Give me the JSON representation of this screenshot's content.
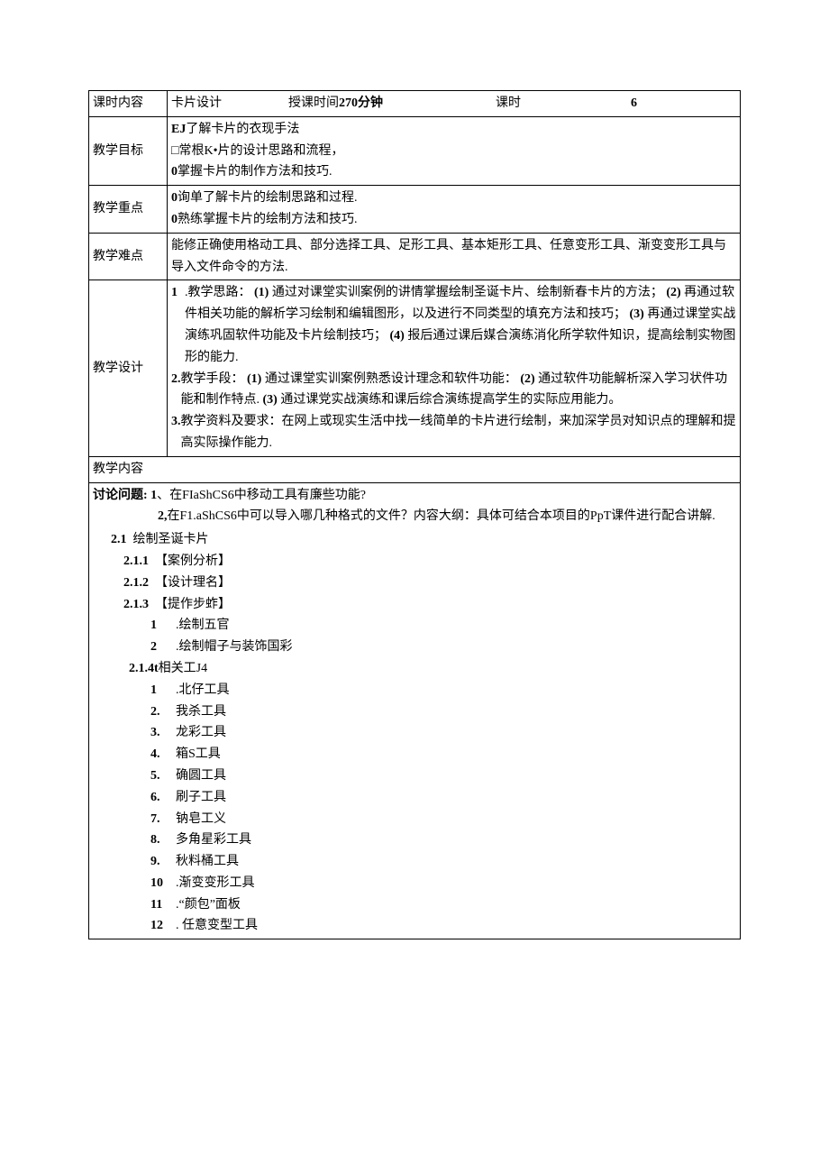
{
  "row1": {
    "lbl_content": "课时内容",
    "topic": "卡片设计",
    "lbl_time": "授课时间",
    "time_val": "270分钟",
    "lbl_hours": "课时",
    "hours_val": "6"
  },
  "goals": {
    "label": "教学目标",
    "l1_pre": "EJ",
    "l1": "了解卡片的衣现手法",
    "l2": "□常根K•片的设计思路和流程，",
    "l3_pre": "0",
    "l3": "掌握卡片的制作方法和技巧."
  },
  "emphasis": {
    "label": "教学重点",
    "l1_pre": "0",
    "l1": "询单了解卡片的绘制思路和过程.",
    "l2_pre": "0",
    "l2": "熟练掌握卡片的绘制方法和技巧."
  },
  "difficulty": {
    "label": "教学难点",
    "text": "能修正确使用格动工具、部分选择工具、足形工具、基本矩形工具、任意变形工具、渐变变形工具与导入文件命令的方法."
  },
  "design": {
    "label": "教学设计",
    "i1_num": "1",
    "i1_lead": ".教学思路：",
    "i1_p1": "(1)",
    "i1_t1": "通过对课堂实训案例的讲情掌握绘制圣诞卡片、绘制新春卡片的方法；",
    "i1_p2": "(2)",
    "i1_t2": "再通过软件相关功能的解析学习绘制和编辑图形，以及进行不同类型的填充方法和技巧；",
    "i1_p3": "(3)",
    "i1_t3": "再通过课堂实战演练巩固软件功能及卡片绘制技巧；",
    "i1_p4": "(4)",
    "i1_t4": "报后通过课后媒合演练消化所学软件知识，提高绘制实物图形的能力.",
    "i2_num": "2.",
    "i2_lead": "教学手段：",
    "i2_p1": "(1)",
    "i2_t1": "通过课堂实训案例熟悉设计理念和软件功能：",
    "i2_p2": "(2)",
    "i2_t2": "通过软件功能解析深入学习状件功能和制作特点.",
    "i2_p3": "(3)",
    "i2_t3": "通过课党实战演练和课后综合演练提高学生的实际应用能力。",
    "i3_num": "3.",
    "i3_text": "教学资料及要求：在网上或现实生活中找一线简单的卡片进行绘制，来加深学员对知识点的理解和提高实际操作能力."
  },
  "content_label": "教学内容",
  "body": {
    "discuss_lead": "讨论问题:",
    "d1_num": "1",
    "d1": "、在FIaShCS6中移动工具有廉些功能?",
    "d2_num": "2,",
    "d2": "在F1.aShCS6中可以导入哪几种格式的文件？内容大纲：具体可结合本项目的PpT课件进行配合讲解.",
    "s21_num": "2.1",
    "s21": "绘制圣诞卡片",
    "s211_num": "2.1.1",
    "s211": "【案例分析】",
    "s212_num": "2.1.2",
    "s212": "【设计理名】",
    "s213_num": "2.1.3",
    "s213": "【提作步蚱】",
    "step1_num": "1",
    "step1": ".绘制五官",
    "step2_num": "2",
    "step2": ".绘制帽子与装饰国彩",
    "s214_num": "2.1.4t",
    "s214": "相关工J4",
    "tools": [
      {
        "n": "1",
        "t": ".北仔工具"
      },
      {
        "n": "2.",
        "t": "我杀工具"
      },
      {
        "n": "3.",
        "t": "龙彩工具"
      },
      {
        "n": "4.",
        "t": "箱S工具"
      },
      {
        "n": "5.",
        "t": "确圆工具"
      },
      {
        "n": "6.",
        "t": "刷子工具"
      },
      {
        "n": "7.",
        "t": "钠皂工义"
      },
      {
        "n": "8.",
        "t": "多角星彩工具"
      },
      {
        "n": "9.",
        "t": "秋料桶工具"
      },
      {
        "n": "10",
        "t": ".渐变变形工具"
      },
      {
        "n": "11",
        "t": ".“颜包”面板"
      },
      {
        "n": "12",
        "t": ". 任意变型工具"
      }
    ]
  }
}
